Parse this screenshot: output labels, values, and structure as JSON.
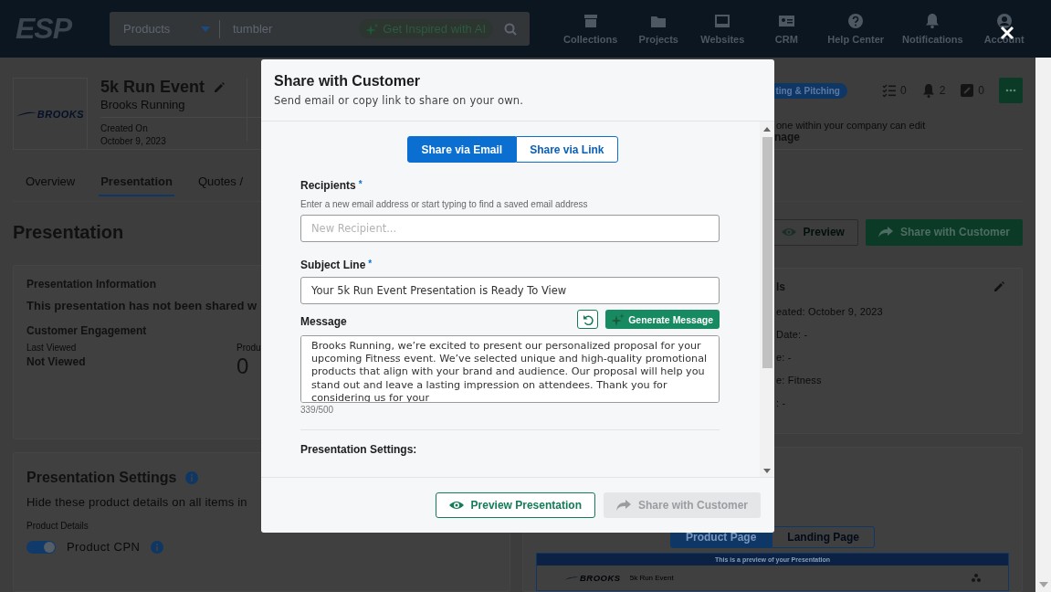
{
  "top_nav": {
    "logo": "ESP",
    "search": {
      "category": "Products",
      "query": "tumbler",
      "ai_button": "Get Inspired with AI"
    },
    "items": [
      {
        "label": "Collections"
      },
      {
        "label": "Projects"
      },
      {
        "label": "Websites"
      },
      {
        "label": "CRM"
      },
      {
        "label": "Help Center"
      },
      {
        "label": "Notifications"
      },
      {
        "label": "Account"
      }
    ]
  },
  "project": {
    "logo_text": "BROOKS",
    "title": "5k Run Event",
    "client": "Brooks Running",
    "created_label": "Created On",
    "created_date": "October 9, 2023",
    "status": "ting & Pitching",
    "counters": [
      {
        "kind": "tasks",
        "value": "0"
      },
      {
        "kind": "alerts",
        "value": "2"
      },
      {
        "kind": "notes",
        "value": "0"
      }
    ],
    "access_note": "one within your company can edit",
    "access_value": "nage"
  },
  "tabs": [
    {
      "label": "Overview",
      "selected": false
    },
    {
      "label": "Presentation",
      "selected": true
    },
    {
      "label": "Quotes /",
      "selected": false
    }
  ],
  "page_title": "Presentation",
  "actions": [
    {
      "kind": "outline",
      "label": "Preview"
    },
    {
      "kind": "primary",
      "label": "Share with Customer"
    }
  ],
  "info_card": {
    "title": "Presentation Information",
    "status_text": "This presentation has not been shared w",
    "engagement_title": "Customer Engagement",
    "last_viewed_label": "Last Viewed",
    "last_viewed_value": "Not Viewed",
    "products_label": "Produ",
    "products_value": "0"
  },
  "settings_card": {
    "title": "Presentation Settings",
    "hint": "Hide these product details on all items in",
    "group_label": "Product Details",
    "toggles": [
      {
        "label": "Product CPN",
        "on": true
      }
    ]
  },
  "details_card": {
    "title": "ls",
    "lines": [
      "eated: October 9, 2023",
      "Date: -",
      "e: -",
      "e: Fitness",
      ": -"
    ]
  },
  "preview": {
    "tabs": [
      {
        "label": "Product Page",
        "selected": true
      },
      {
        "label": "Landing Page",
        "selected": false
      }
    ],
    "banner": "This is a preview of your Presentation",
    "logo_text": "BROOKS",
    "title": "5k Run Event"
  },
  "modal": {
    "title": "Share with Customer",
    "subtitle": "Send email or copy link to share on your own.",
    "modes": [
      {
        "label": "Share via Email",
        "selected": true
      },
      {
        "label": "Share via Link",
        "selected": false
      }
    ],
    "recipients": {
      "label": "Recipients",
      "required_mark": "*",
      "hint": "Enter a new email address or start typing to find a saved email address",
      "placeholder": "New Recipient..."
    },
    "subject": {
      "label": "Subject Line",
      "required_mark": "*",
      "value": "Your 5k Run Event Presentation is Ready To View"
    },
    "message": {
      "label": "Message",
      "generate_button": "Generate Message",
      "value": "Brooks Running, we’re excited to present our personalized proposal for your upcoming Fitness event. We’ve selected unique and high-quality promotional products that align with your brand and audience. Our proposal will help you stand out and leave a lasting impression on attendees. Thank you for considering us for your",
      "counter": "339/500"
    },
    "settings_label": "Presentation Settings:",
    "buttons": [
      {
        "kind": "outline",
        "label": "Preview Presentation",
        "disabled": false
      },
      {
        "kind": "primary",
        "label": "Share with Customer",
        "disabled": true
      }
    ]
  }
}
